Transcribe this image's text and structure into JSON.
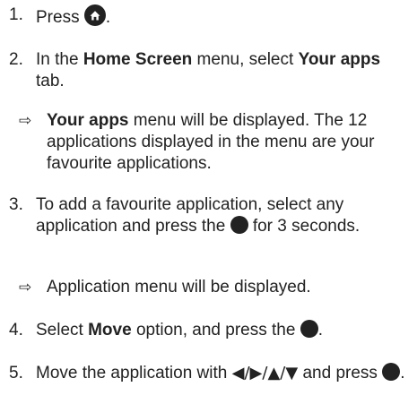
{
  "steps": [
    {
      "number": "1.",
      "text_before": "Press",
      "icon": "home-icon",
      "text_after": "."
    },
    {
      "number": "2.",
      "pre": "In the ",
      "bold1": "Home Screen",
      "mid": " menu, select ",
      "bold2": "Your apps",
      "post": " tab.",
      "result": {
        "arrow": "⇨",
        "bold": "Your apps",
        "text": " menu will be displayed. The 12 applications displayed in the menu are your favourite applications."
      }
    },
    {
      "number": "3.",
      "pre": "To add a favourite application, select any application and press the ",
      "icon": "ok-button-icon",
      "post": " for 3 seconds.",
      "result": {
        "arrow": "⇨",
        "text": "Application menu will be displayed."
      }
    },
    {
      "number": "4.",
      "pre": "Select ",
      "bold": "Move",
      "mid": " option, and press the ",
      "icon": "ok-button-icon",
      "post": "."
    },
    {
      "number": "5.",
      "pre": "Move the application with ",
      "directions": "◀/▶/▲/▼",
      "mid": " and press ",
      "icon": "ok-button-icon",
      "post": "."
    }
  ]
}
